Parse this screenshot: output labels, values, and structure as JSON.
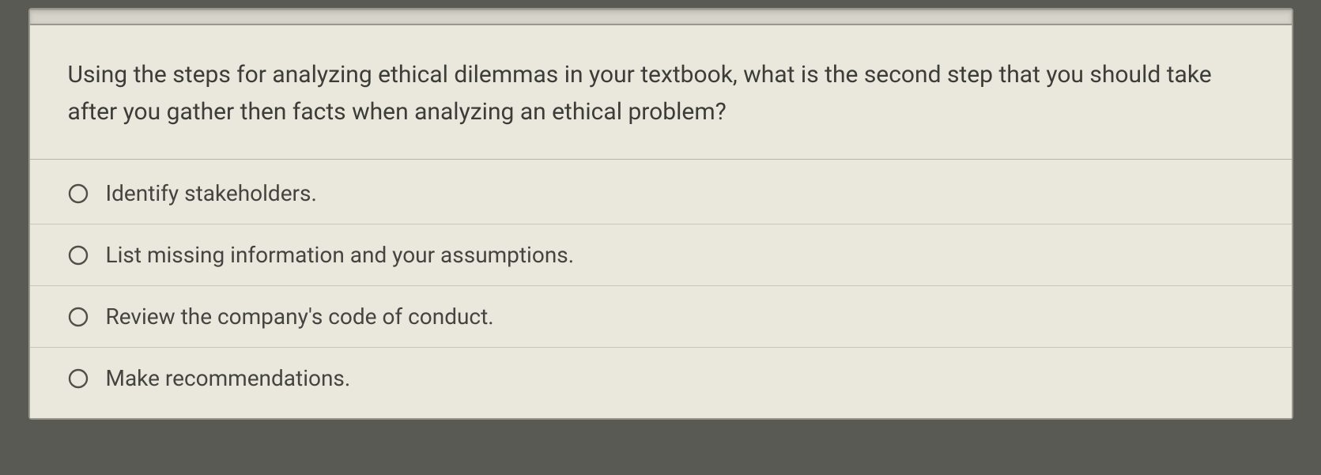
{
  "question": {
    "prompt": "Using the steps for analyzing ethical dilemmas in your textbook, what is the second step that you should take after you gather then facts when analyzing an ethical problem?",
    "options": [
      {
        "label": "Identify stakeholders."
      },
      {
        "label": "List missing information and your assumptions."
      },
      {
        "label": "Review the company's code of conduct."
      },
      {
        "label": "Make recommendations."
      }
    ]
  }
}
